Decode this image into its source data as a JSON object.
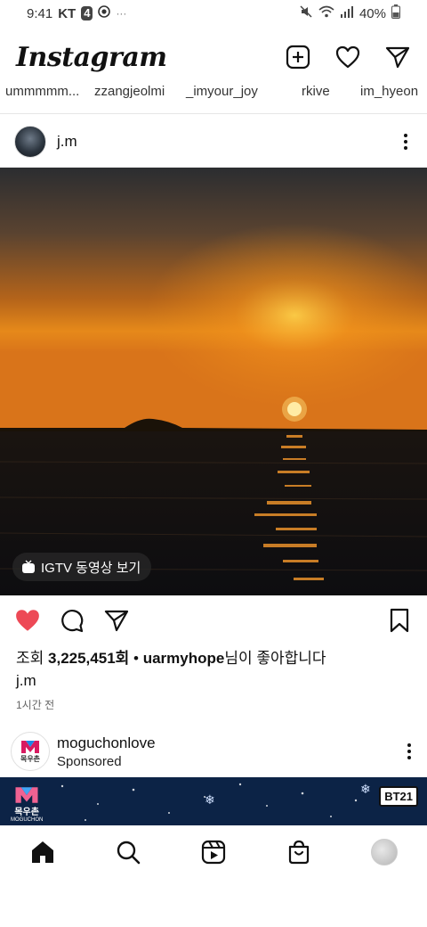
{
  "status_bar": {
    "time": "9:41",
    "carrier": "KT",
    "carrier_badge": "4",
    "battery": "40%",
    "signal_icons": [
      "mute-icon",
      "wifi-icon",
      "signal-icon",
      "battery-icon"
    ]
  },
  "header": {
    "logo": "Instagram",
    "actions": [
      "new-post-icon",
      "activity-heart-icon",
      "direct-message-icon"
    ]
  },
  "stories": [
    "ummmmm...",
    "zzangjeolmi",
    "_imyour_joy",
    "rkive",
    "im_hyeon"
  ],
  "post": {
    "username": "j.m",
    "igtv_label": "IGTV 동영상 보기",
    "liked": true,
    "views_prefix": "조회 ",
    "views_count": "3,225,451회",
    "separator": " • ",
    "liked_by": "uarmyhope",
    "liked_suffix": "님이 좋아합니다",
    "caption_user": "j.m",
    "timestamp": "1시간 전"
  },
  "post2": {
    "username": "moguchonlove",
    "sponsored": "Sponsored",
    "avatar_text": "목우촌",
    "banner_logo_text": "목우촌",
    "banner_logo_subtext": "MOGUCHON",
    "banner_badge": "BT21"
  },
  "bottom_nav": [
    "home-icon",
    "search-icon",
    "reels-icon",
    "shop-icon",
    "profile-avatar"
  ],
  "colors": {
    "like_red": "#ed4956",
    "ad_bg": "#0c2346",
    "accent_text": "#111111"
  }
}
